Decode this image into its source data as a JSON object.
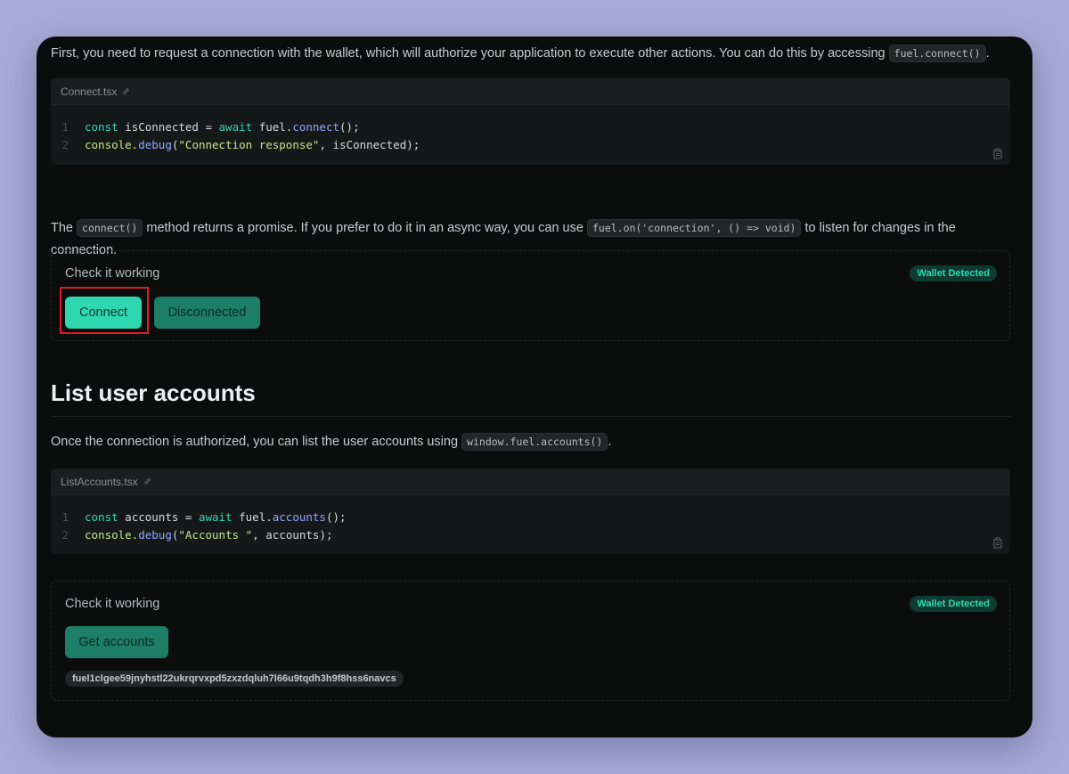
{
  "intro": {
    "text": "First, you need to request a connection with the wallet, which will authorize your application to execute other actions. You can do this by accessing",
    "code": "fuel.connect()",
    "end": "."
  },
  "code1": {
    "filename": "Connect.tsx",
    "lines": [
      {
        "num": "1",
        "t1": "const",
        "t2": " isConnected = ",
        "t3": "await",
        "t4": " fuel.",
        "t5": "connect",
        "t6": "();"
      },
      {
        "num": "2",
        "t1": "console.",
        "t2": "debug",
        "t3": "(",
        "t4": "\"Connection response\"",
        "t5": ", isConnected);"
      }
    ]
  },
  "para2": {
    "a": "The",
    "code1": "connect()",
    "b": "method returns a promise. If you prefer to do it in an async way, you can use",
    "code2": "fuel.on('connection', () => void)",
    "c": "to listen for changes in the connection."
  },
  "demo1": {
    "title": "Check it working",
    "badge": "Wallet Detected",
    "connect_label": "Connect",
    "status_label": "Disconnected"
  },
  "section": {
    "heading": "List user accounts"
  },
  "para3": {
    "text": "Once the connection is authorized, you can list the user accounts using",
    "code": "window.fuel.accounts()",
    "end": "."
  },
  "code2": {
    "filename": "ListAccounts.tsx",
    "lines": [
      {
        "num": "1",
        "t1": "const",
        "t2": " accounts = ",
        "t3": "await",
        "t4": " fuel.",
        "t5": "accounts",
        "t6": "();"
      },
      {
        "num": "2",
        "t1": "console.",
        "t2": "debug",
        "t3": "(",
        "t4": "\"Accounts \"",
        "t5": ", accounts);"
      }
    ]
  },
  "demo2": {
    "title": "Check it working",
    "badge": "Wallet Detected",
    "button_label": "Get accounts",
    "address": "fuel1clgee59jnyhstl22ukrqrvxpd5zxzdqluh7l66u9tqdh3h9f8hss6navcs"
  },
  "colors": {
    "accent": "#2fd7b1",
    "highlight": "#e31b23",
    "background": "#0b0d0d"
  },
  "icons": [
    "link-icon",
    "copy-icon"
  ]
}
